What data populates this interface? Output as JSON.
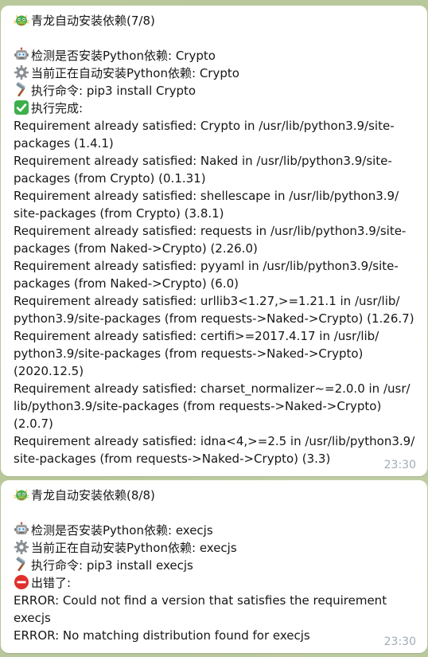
{
  "messages": [
    {
      "title": "青龙自动安装依赖(7/8)",
      "check": "检测是否安装Python依赖: Crypto",
      "installing": "当前正在自动安装Python依赖: Crypto",
      "command": "执行命令: pip3 install Crypto",
      "status": "执行完成:",
      "output": [
        "Requirement already satisfied: Crypto in /usr/lib/python3.9/site-",
        "packages (1.4.1)",
        "Requirement already satisfied: Naked in /usr/lib/python3.9/site-",
        "packages (from Crypto) (0.1.31)",
        "Requirement already satisfied: shellescape in /usr/lib/python3.9/",
        "site-packages (from Crypto) (3.8.1)",
        "Requirement already satisfied: requests in /usr/lib/python3.9/site-",
        "packages (from Naked->Crypto) (2.26.0)",
        "Requirement already satisfied: pyyaml in /usr/lib/python3.9/site-",
        "packages (from Naked->Crypto) (6.0)",
        "Requirement already satisfied: urllib3<1.27,>=1.21.1 in /usr/lib/",
        "python3.9/site-packages (from requests->Naked->Crypto) (1.26.7)",
        "Requirement already satisfied: certifi>=2017.4.17 in /usr/lib/",
        "python3.9/site-packages (from requests->Naked->Crypto)",
        "(2020.12.5)",
        "Requirement already satisfied: charset_normalizer~=2.0.0 in /usr/",
        "lib/python3.9/site-packages (from requests->Naked->Crypto)",
        "(2.0.7)",
        "Requirement already satisfied: idna<4,>=2.5 in /usr/lib/python3.9/",
        "site-packages (from requests->Naked->Crypto) (3.3)"
      ],
      "time": "23:30"
    },
    {
      "title": "青龙自动安装依赖(8/8)",
      "check": "检测是否安装Python依赖: execjs",
      "installing": "当前正在自动安装Python依赖: execjs",
      "command": "执行命令: pip3 install execjs",
      "status": "出错了:",
      "output": [
        "ERROR: Could not find a version that satisfies the requirement",
        "execjs",
        "ERROR: No matching distribution found for execjs"
      ],
      "time": "23:30"
    }
  ],
  "icons": {
    "dragon": "dragon-icon",
    "robot": "robot-icon",
    "gear": "gear-icon",
    "hammer": "hammer-icon",
    "check": "check-mark-icon",
    "error": "no-entry-icon"
  },
  "colors": {
    "background": "#b9c89a",
    "bubble": "#ffffff",
    "time": "#a0acb6",
    "success": "#3db04b",
    "error": "#e0302c"
  }
}
